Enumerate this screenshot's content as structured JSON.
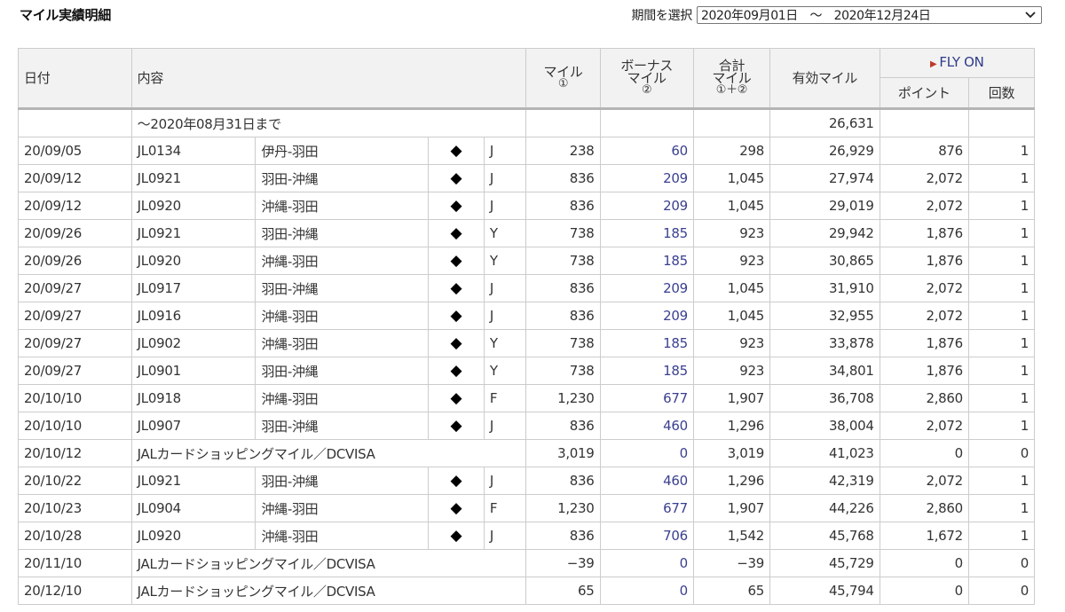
{
  "page": {
    "title": "マイル実績明細"
  },
  "period": {
    "label": "期間を選択",
    "selected": "2020年09月01日　～　2020年12月24日",
    "icon": "chevron-down-icon"
  },
  "table": {
    "headers": {
      "date": "日付",
      "content": "内容",
      "miles_line1": "マイル",
      "miles_line2": "①",
      "bonus_line1": "ボーナス",
      "bonus_line2": "マイル",
      "bonus_line3": "②",
      "total_line1": "合計",
      "total_line2": "マイル",
      "total_line3": "①＋②",
      "effective": "有効マイル",
      "flyon": "FLY ON",
      "points": "ポイント",
      "count": "回数"
    },
    "carryover": {
      "label": "～2020年08月31日まで",
      "effective": "26,631"
    },
    "rows": [
      {
        "date": "20/09/05",
        "flight": "JL0134",
        "route": "伊丹-羽田",
        "mark": "◆",
        "class": "J",
        "miles": "238",
        "bonus": "60",
        "total": "298",
        "effective": "26,929",
        "points": "876",
        "count": "1"
      },
      {
        "date": "20/09/12",
        "flight": "JL0921",
        "route": "羽田-沖縄",
        "mark": "◆",
        "class": "J",
        "miles": "836",
        "bonus": "209",
        "total": "1,045",
        "effective": "27,974",
        "points": "2,072",
        "count": "1"
      },
      {
        "date": "20/09/12",
        "flight": "JL0920",
        "route": "沖縄-羽田",
        "mark": "◆",
        "class": "J",
        "miles": "836",
        "bonus": "209",
        "total": "1,045",
        "effective": "29,019",
        "points": "2,072",
        "count": "1"
      },
      {
        "date": "20/09/26",
        "flight": "JL0921",
        "route": "羽田-沖縄",
        "mark": "◆",
        "class": "Y",
        "miles": "738",
        "bonus": "185",
        "total": "923",
        "effective": "29,942",
        "points": "1,876",
        "count": "1"
      },
      {
        "date": "20/09/26",
        "flight": "JL0920",
        "route": "沖縄-羽田",
        "mark": "◆",
        "class": "Y",
        "miles": "738",
        "bonus": "185",
        "total": "923",
        "effective": "30,865",
        "points": "1,876",
        "count": "1"
      },
      {
        "date": "20/09/27",
        "flight": "JL0917",
        "route": "羽田-沖縄",
        "mark": "◆",
        "class": "J",
        "miles": "836",
        "bonus": "209",
        "total": "1,045",
        "effective": "31,910",
        "points": "2,072",
        "count": "1"
      },
      {
        "date": "20/09/27",
        "flight": "JL0916",
        "route": "沖縄-羽田",
        "mark": "◆",
        "class": "J",
        "miles": "836",
        "bonus": "209",
        "total": "1,045",
        "effective": "32,955",
        "points": "2,072",
        "count": "1"
      },
      {
        "date": "20/09/27",
        "flight": "JL0902",
        "route": "沖縄-羽田",
        "mark": "◆",
        "class": "Y",
        "miles": "738",
        "bonus": "185",
        "total": "923",
        "effective": "33,878",
        "points": "1,876",
        "count": "1"
      },
      {
        "date": "20/09/27",
        "flight": "JL0901",
        "route": "羽田-沖縄",
        "mark": "◆",
        "class": "Y",
        "miles": "738",
        "bonus": "185",
        "total": "923",
        "effective": "34,801",
        "points": "1,876",
        "count": "1"
      },
      {
        "date": "20/10/10",
        "flight": "JL0918",
        "route": "沖縄-羽田",
        "mark": "◆",
        "class": "F",
        "miles": "1,230",
        "bonus": "677",
        "total": "1,907",
        "effective": "36,708",
        "points": "2,860",
        "count": "1"
      },
      {
        "date": "20/10/10",
        "flight": "JL0907",
        "route": "羽田-沖縄",
        "mark": "◆",
        "class": "J",
        "miles": "836",
        "bonus": "460",
        "total": "1,296",
        "effective": "38,004",
        "points": "2,072",
        "count": "1"
      },
      {
        "date": "20/10/12",
        "content": "JALカードショッピングマイル／DCVISA",
        "miles": "3,019",
        "bonus": "0",
        "total": "3,019",
        "effective": "41,023",
        "points": "0",
        "count": "0"
      },
      {
        "date": "20/10/22",
        "flight": "JL0921",
        "route": "羽田-沖縄",
        "mark": "◆",
        "class": "J",
        "miles": "836",
        "bonus": "460",
        "total": "1,296",
        "effective": "42,319",
        "points": "2,072",
        "count": "1"
      },
      {
        "date": "20/10/23",
        "flight": "JL0904",
        "route": "沖縄-羽田",
        "mark": "◆",
        "class": "F",
        "miles": "1,230",
        "bonus": "677",
        "total": "1,907",
        "effective": "44,226",
        "points": "2,860",
        "count": "1"
      },
      {
        "date": "20/10/28",
        "flight": "JL0920",
        "route": "沖縄-羽田",
        "mark": "◆",
        "class": "J",
        "miles": "836",
        "bonus": "706",
        "total": "1,542",
        "effective": "45,768",
        "points": "1,672",
        "count": "1"
      },
      {
        "date": "20/11/10",
        "content": "JALカードショッピングマイル／DCVISA",
        "miles": "−39",
        "bonus": "0",
        "total": "−39",
        "effective": "45,729",
        "points": "0",
        "count": "0"
      },
      {
        "date": "20/12/10",
        "content": "JALカードショッピングマイル／DCVISA",
        "miles": "65",
        "bonus": "0",
        "total": "65",
        "effective": "45,794",
        "points": "0",
        "count": "0"
      }
    ]
  },
  "colors": {
    "bonus": "#3a3f8f",
    "flyon": "#2f3c8a",
    "flyon_arrow": "#c0392b",
    "header_bg": "#f2f2f2"
  }
}
